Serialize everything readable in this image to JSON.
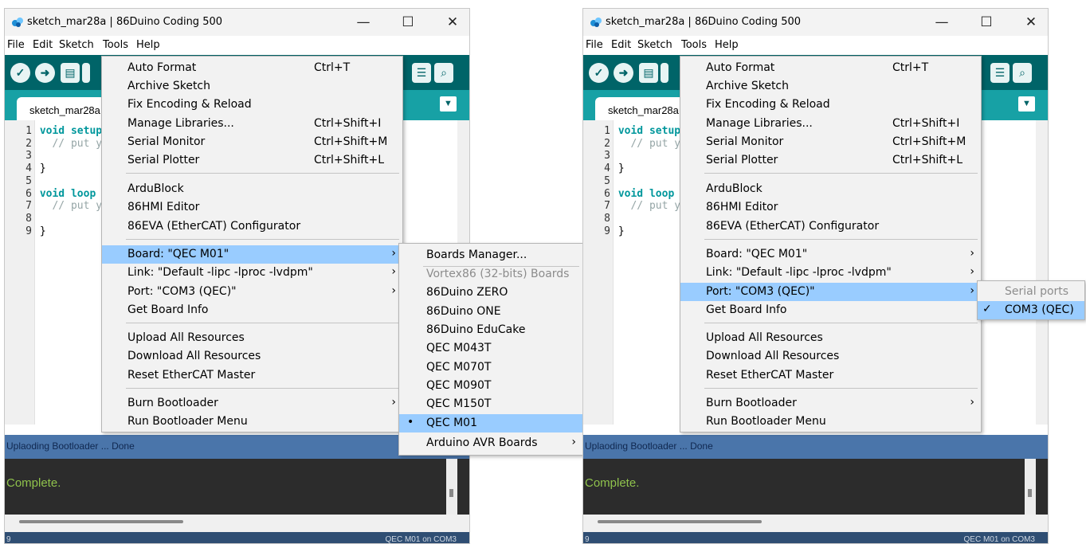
{
  "window": {
    "title": "sketch_mar28a | 86Duino Coding 500",
    "minimize": "—",
    "maximize": "☐",
    "close": "✕"
  },
  "menubar": {
    "file": "File",
    "edit": "Edit",
    "sketch": "Sketch",
    "tools": "Tools",
    "help": "Help"
  },
  "toolbar": {
    "verify": "✓",
    "upload": "➜",
    "new": "▤",
    "serial_plotter": "☰",
    "serial_monitor": "⌕"
  },
  "tab": {
    "name": "sketch_mar28a",
    "dropdown": "▼"
  },
  "code": [
    {
      "n": "1",
      "kw": "void setup",
      "rest": ""
    },
    {
      "n": "2",
      "kw": "",
      "rest": "  // put y"
    },
    {
      "n": "3",
      "kw": "",
      "rest": ""
    },
    {
      "n": "4",
      "kw": "",
      "rest": "}"
    },
    {
      "n": "5",
      "kw": "",
      "rest": ""
    },
    {
      "n": "6",
      "kw": "void loop",
      "rest": ""
    },
    {
      "n": "7",
      "kw": "",
      "rest": "  // put y"
    },
    {
      "n": "8",
      "kw": "",
      "rest": ""
    },
    {
      "n": "9",
      "kw": "",
      "rest": "}"
    }
  ],
  "status": {
    "message": "Uplaoding Bootloader ... Done",
    "console": "Complete.",
    "line": "9",
    "board_port": "QEC M01 on COM3"
  },
  "tools_menu": {
    "auto_format": "Auto Format",
    "auto_format_sc": "Ctrl+T",
    "archive_sketch": "Archive Sketch",
    "fix_encoding": "Fix Encoding & Reload",
    "manage_libraries": "Manage Libraries...",
    "manage_libraries_sc": "Ctrl+Shift+I",
    "serial_monitor": "Serial Monitor",
    "serial_monitor_sc": "Ctrl+Shift+M",
    "serial_plotter": "Serial Plotter",
    "serial_plotter_sc": "Ctrl+Shift+L",
    "ardublock": "ArduBlock",
    "hmi_editor": "86HMI Editor",
    "eva_configurator": "86EVA (EtherCAT) Configurator",
    "board": "Board: \"QEC M01\"",
    "link": "Link: \"Default -lipc -lproc -lvdpm\"",
    "port": "Port: \"COM3 (QEC)\"",
    "get_board_info": "Get Board Info",
    "upload_all": "Upload All Resources",
    "download_all": "Download All Resources",
    "reset_ethercat": "Reset EtherCAT Master",
    "burn_bootloader": "Burn Bootloader",
    "run_bootloader_menu": "Run Bootloader Menu",
    "arrow": "›"
  },
  "board_submenu": {
    "boards_manager": "Boards Manager...",
    "vortex_header": "Vortex86 (32-bits) Boards",
    "items": [
      "86Duino ZERO",
      "86Duino ONE",
      "86Duino EduCake",
      "QEC M043T",
      "QEC M070T",
      "QEC M090T",
      "QEC M150T",
      "QEC M01"
    ],
    "selected_bullet": "•",
    "arduino_avr": "Arduino AVR Boards"
  },
  "port_submenu": {
    "header": "Serial ports",
    "item": "COM3 (QEC)",
    "check": "✓"
  }
}
